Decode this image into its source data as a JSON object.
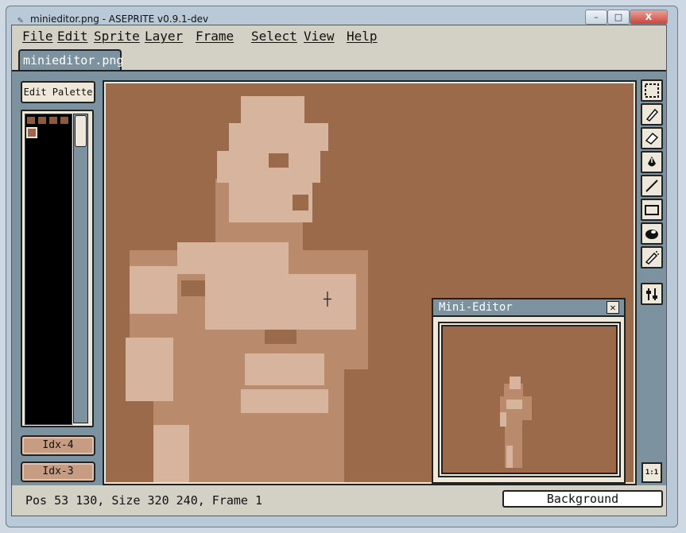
{
  "window": {
    "title": "minieditor.png - ASEPRITE v0.9.1-dev",
    "controls": {
      "minimize": "–",
      "maximize": "□",
      "close": "X"
    }
  },
  "menu": [
    "File",
    "Edit",
    "Sprite",
    "Layer",
    "Frame",
    "Select",
    "View",
    "Help"
  ],
  "tab": {
    "label": "minieditor.png"
  },
  "palette": {
    "edit_button_label": "Edit Palette",
    "colors": [
      "#8c5a3e",
      "#9b6a4b",
      "#b78a6e",
      "#d9b8a2"
    ],
    "foreground_label": "Idx-4",
    "background_label": "Idx-3"
  },
  "mini_editor": {
    "title": "Mini-Editor",
    "close_label": "☒"
  },
  "tools": [
    "marquee-icon",
    "pencil-icon",
    "eraser-icon",
    "fill-bucket-icon",
    "line-icon",
    "rectangle-icon",
    "blur-icon",
    "spray-icon",
    "configure-icon"
  ],
  "zoom": {
    "label": "1:1"
  },
  "status": {
    "text": "Pos 53 130, Size 320 240, Frame 1",
    "layer": "Background"
  },
  "colors": {
    "canvas_bg": "#9b6a4b",
    "workspace": "#7d929f",
    "panel": "#ede8d9",
    "figure_light": "#d6b49e",
    "figure_mid": "#b98a6c"
  }
}
